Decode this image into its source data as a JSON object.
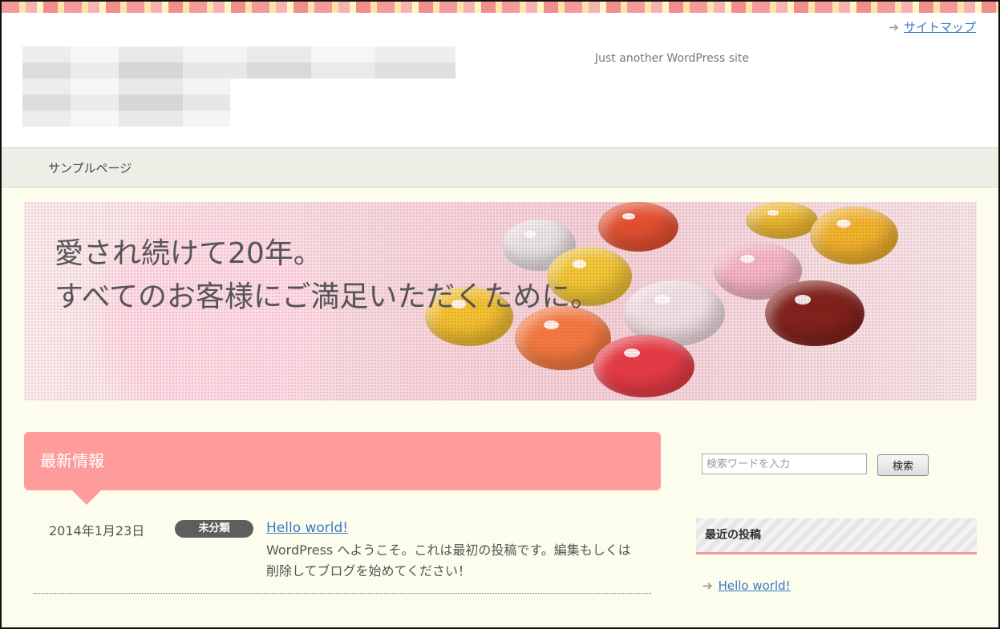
{
  "header": {
    "tagline": "Just another WordPress site",
    "sitemap_label": "サイトマップ",
    "arrow_icon": "arrow-right-icon"
  },
  "nav": {
    "items": [
      {
        "label": "サンプルページ"
      }
    ]
  },
  "hero": {
    "line1": "愛され続けて20年。",
    "line2": "すべてのお客様にご満足いただくために。"
  },
  "news": {
    "title": "最新情報",
    "posts": [
      {
        "date": "2014年1月23日",
        "category": "未分類",
        "title": "Hello world!",
        "excerpt": "WordPress へようこそ。これは最初の投稿です。編集もしくは削除してブログを始めてください！"
      }
    ]
  },
  "sidebar": {
    "search_placeholder": "検索ワードを入力",
    "search_button": "検索",
    "recent_title": "最近の投稿",
    "recent_posts": [
      {
        "title": "Hello world!"
      }
    ]
  },
  "colors": {
    "accent": "#fe9c9c",
    "link": "#3a78c2",
    "background": "#fdfdee"
  }
}
